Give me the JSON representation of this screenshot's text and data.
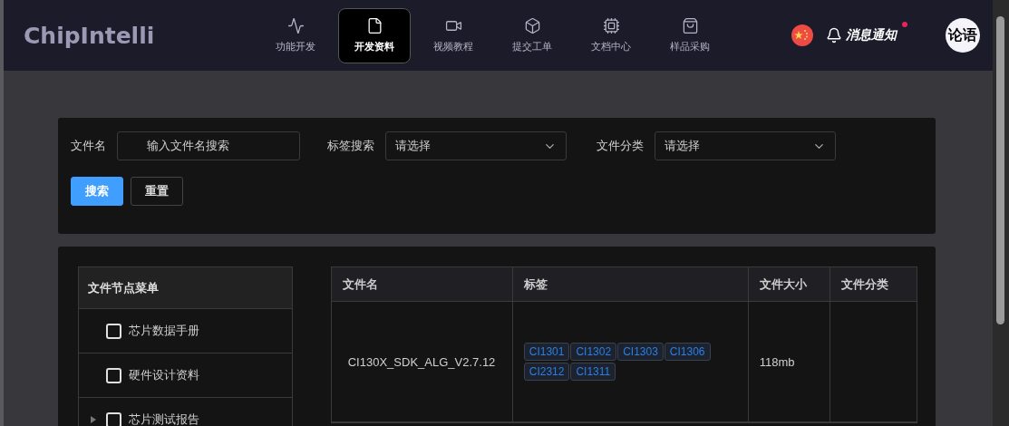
{
  "header": {
    "logo": "ChipIntelli",
    "nav": [
      {
        "label": "功能开发",
        "selected": false
      },
      {
        "label": "开发资料",
        "selected": true
      },
      {
        "label": "视频教程",
        "selected": false
      },
      {
        "label": "提交工单",
        "selected": false
      },
      {
        "label": "文档中心",
        "selected": false
      },
      {
        "label": "样品采购",
        "selected": false
      }
    ],
    "notifications": {
      "label": "消息通知",
      "unread": true
    },
    "avatar": "论语"
  },
  "filters": {
    "fields": [
      {
        "label": "文件名",
        "kind": "input",
        "placeholder": "输入文件名搜索"
      },
      {
        "label": "标签搜索",
        "kind": "select",
        "placeholder": "请选择"
      },
      {
        "label": "文件分类",
        "kind": "select",
        "placeholder": "请选择"
      }
    ],
    "buttons": [
      {
        "label": "搜索",
        "kind": "primary"
      },
      {
        "label": "重置",
        "kind": "default"
      }
    ]
  },
  "tree": {
    "title": "文件节点菜单",
    "items": [
      {
        "label": "芯片数据手册",
        "kind": "leaf",
        "checked": false
      },
      {
        "label": "硬件设计资料",
        "kind": "leaf",
        "checked": false
      },
      {
        "label": "芯片测试报告",
        "kind": "branch",
        "checked": false
      }
    ]
  },
  "table": {
    "columns": [
      "文件名",
      "标签",
      "文件大小",
      "文件分类"
    ],
    "rows": [
      {
        "name": "CI130X_SDK_ALG_V2.7.12",
        "tags": [
          "CI1301",
          "CI1302",
          "CI1303",
          "CI1306",
          "CI2312",
          "CI1311"
        ],
        "size": "118mb"
      }
    ]
  }
}
